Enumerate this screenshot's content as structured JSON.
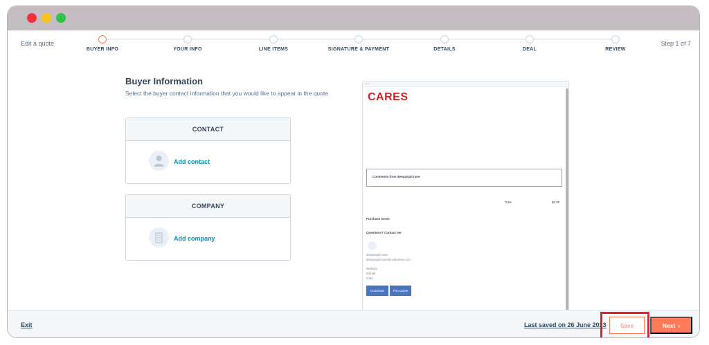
{
  "header": {
    "edit_label": "Edit a quote",
    "step_count": "Step 1 of 7"
  },
  "steps": [
    {
      "label": "BUYER INFO",
      "active": true
    },
    {
      "label": "YOUR INFO",
      "active": false
    },
    {
      "label": "LINE ITEMS",
      "active": false
    },
    {
      "label": "SIGNATURE & PAYMENT",
      "active": false
    },
    {
      "label": "DETAILS",
      "active": false
    },
    {
      "label": "DEAL",
      "active": false
    },
    {
      "label": "REVIEW",
      "active": false
    }
  ],
  "main": {
    "title": "Buyer Information",
    "subtitle": "Select the buyer contact information that you would like to appear in the quote"
  },
  "contact_card": {
    "header": "CONTACT",
    "link": "Add contact",
    "icon": "person-icon"
  },
  "company_card": {
    "header": "COMPANY",
    "link": "Add company",
    "icon": "building-icon"
  },
  "preview": {
    "logo": "CARES",
    "comments": "Comments from deepanjali rane",
    "total_label": "Total",
    "total_value": "$0.00",
    "purchase_terms": "Purchase terms",
    "questions": "Questions? Contact me",
    "contact_name": "deepanjali rane",
    "contact_email": "deepanjali.rane@cvahokey.com",
    "address_line1": "Website",
    "address_line2": "Mohali",
    "address_line3": "India",
    "download_btn": "Download",
    "print_btn": "Print quote"
  },
  "footer": {
    "exit": "Exit",
    "last_saved": "Last saved on 26 June 2023",
    "save": "Save",
    "next": "Next"
  },
  "colors": {
    "accent": "#ff7a59",
    "link": "#0091ae",
    "highlight": "#e01f2b"
  }
}
